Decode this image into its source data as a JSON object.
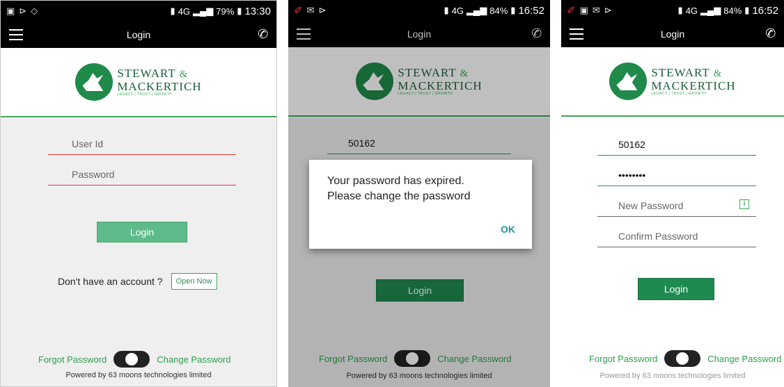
{
  "panels": [
    {
      "status": {
        "time": "13:30",
        "battery": "79%",
        "network": "4G"
      },
      "appbar": {
        "title": "Login"
      },
      "logo": {
        "line1": "STEWART",
        "amp": "&",
        "line2": "MACKERTICH",
        "tagline": "LEGACY | TRUST | GROWTH"
      },
      "user_placeholder": "User Id",
      "password_placeholder": "Password",
      "login_label": "Login",
      "no_account_text": "Don't have an account ?",
      "open_now_label": "Open Now",
      "forgot_label": "Forgot Password",
      "change_label": "Change Password",
      "powered_by": "Powered by 63 moons technologies limited"
    },
    {
      "status": {
        "time": "16:52",
        "battery": "84%",
        "network": "4G"
      },
      "appbar": {
        "title": "Login"
      },
      "logo": {
        "line1": "STEWART",
        "amp": "&",
        "line2": "MACKERTICH",
        "tagline": "LEGACY | TRUST | GROWTH"
      },
      "user_value": "50162",
      "dialog": {
        "message_line1": "Your password has expired.",
        "message_line2": "Please change the password",
        "ok_label": "OK"
      },
      "login_label": "Login",
      "forgot_label": "Forgot Password",
      "change_label": "Change Password",
      "powered_by": "Powered by 63 moons technologies limited"
    },
    {
      "status": {
        "time": "16:52",
        "battery": "84%",
        "network": "4G"
      },
      "appbar": {
        "title": "Login"
      },
      "logo": {
        "line1": "STEWART",
        "amp": "&",
        "line2": "MACKERTICH",
        "tagline": "LEGACY | TRUST | GROWTH"
      },
      "user_value": "50162",
      "password_value": "••••••••",
      "new_password_placeholder": "New Password",
      "confirm_password_placeholder": "Confirm Password",
      "info_icon_glyph": "i",
      "login_label": "Login",
      "forgot_label": "Forgot Password",
      "change_label": "Change Password",
      "powered_by": "Powered by 63 moons technologies limited"
    }
  ],
  "colors": {
    "accent_green": "#3aa655",
    "dark_green": "#1f8a4f",
    "error_red": "#e53935",
    "ok_blue": "#2196a6"
  }
}
